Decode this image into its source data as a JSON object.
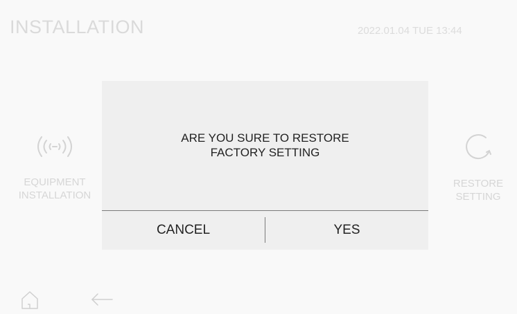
{
  "header": {
    "title": "INSTALLATION",
    "datetime": "2022.01.04 TUE 13:44"
  },
  "tiles": {
    "equipment": {
      "line1": "EQUIPMENT",
      "line2": "INSTALLATION",
      "icon": "signal-broadcast-icon"
    },
    "restore": {
      "line1": "RESTORE",
      "line2": "SETTING",
      "icon": "restore-circle-icon"
    }
  },
  "dialog": {
    "message_line1": "ARE YOU SURE TO RESTORE",
    "message_line2": "FACTORY SETTING",
    "cancel_label": "CANCEL",
    "yes_label": "YES"
  },
  "nav": {
    "home_icon": "home-icon",
    "back_icon": "back-arrow-icon"
  },
  "colors": {
    "background": "#f9f9f9",
    "dialog": "#efefef",
    "faded_text": "#d6d6d6",
    "dialog_text": "#222222"
  }
}
